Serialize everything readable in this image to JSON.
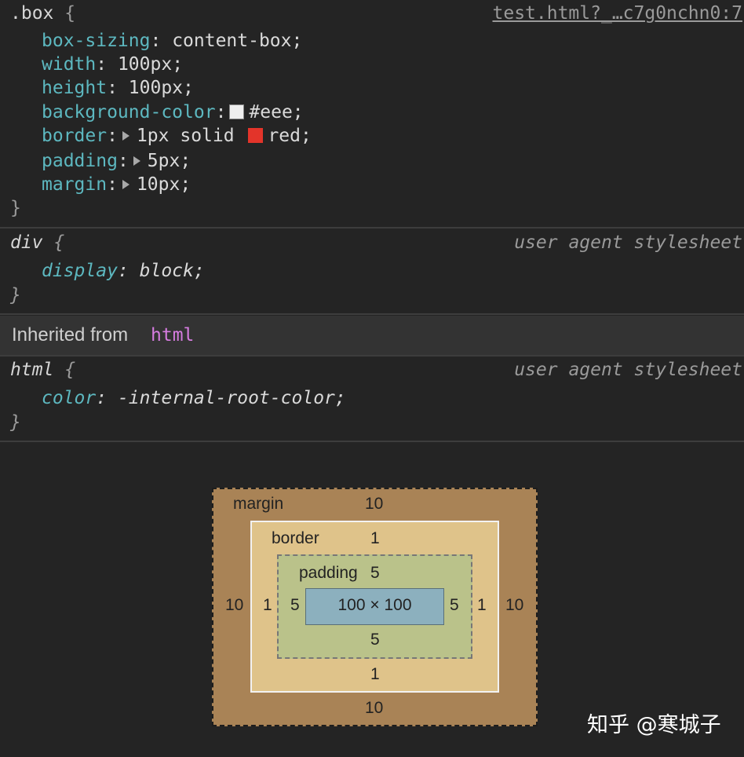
{
  "rules": [
    {
      "selector": ".box",
      "open_brace": "{",
      "close_brace": "}",
      "source": "test.html?_…c7g0nchn0:7",
      "declarations": [
        {
          "name": "box-sizing",
          "value": "content-box;"
        },
        {
          "name": "width",
          "value": "100px;"
        },
        {
          "name": "height",
          "value": "100px;"
        },
        {
          "name": "background-color",
          "value": "#eee;",
          "swatch": "#eeeeee"
        },
        {
          "name": "border",
          "value": "1px solid ",
          "value2": "red;",
          "swatch": "#e3342a"
        },
        {
          "name": "padding",
          "value": "5px;"
        },
        {
          "name": "margin",
          "value": "10px;"
        }
      ]
    },
    {
      "selector": "div",
      "open_brace": "{",
      "close_brace": "}",
      "source": "user agent stylesheet",
      "declarations": [
        {
          "name": "display",
          "value": "block;"
        }
      ]
    },
    {
      "selector": "html",
      "open_brace": "{",
      "close_brace": "}",
      "source": "user agent stylesheet",
      "declarations": [
        {
          "name": "color",
          "value": "-internal-root-color;"
        }
      ]
    }
  ],
  "inherited": {
    "label": "Inherited from",
    "tag": "html"
  },
  "box_model": {
    "margin": {
      "label": "margin",
      "top": "10",
      "right": "10",
      "bottom": "10",
      "left": "10"
    },
    "border": {
      "label": "border",
      "top": "1",
      "right": "1",
      "bottom": "1",
      "left": "1"
    },
    "padding": {
      "label": "padding",
      "top": "5",
      "right": "5",
      "bottom": "5",
      "left": "5"
    },
    "content": "100 × 100"
  },
  "watermark": "知乎 @寒城子",
  "colors": {
    "background": "#242424",
    "property": "#5db8c0",
    "tag_purple": "#d67ce0",
    "margin": "#a98356",
    "border": "#dfc38a",
    "padding": "#bac28a",
    "content": "#8cb0be"
  }
}
